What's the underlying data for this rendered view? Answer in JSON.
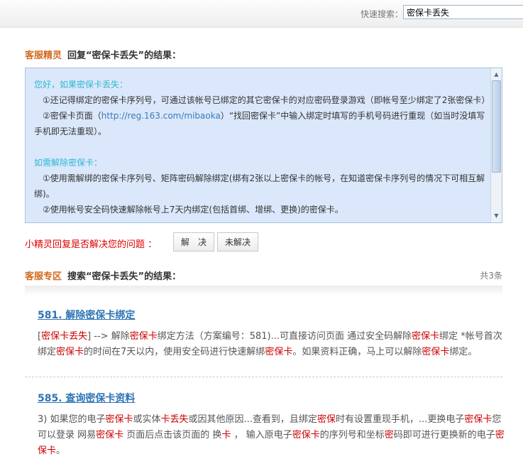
{
  "search": {
    "label": "快速搜索：",
    "value": "密保卡丢失"
  },
  "section1": {
    "accent": "客服精灵",
    "title": "回复“密保卡丢失”的结果："
  },
  "answer": {
    "intro": "您好，如果密保卡丢失：",
    "p1": "①还记得绑定的密保卡序列号，可通过该帐号已绑定的其它密保卡的对应密码登录游戏（即帐号至少绑定了2张密保卡）",
    "p2_pre": "②密保卡页面（",
    "p2_link": "http://reg.163.com/mibaoka",
    "p2_post": "）“找回密保卡”中输入绑定时填写的手机号码进行重现（如当时没填写手机即无法重现）。",
    "intro2": "如需解除密保卡：",
    "p3": "①使用需解绑的密保卡序列号、矩阵密码解除绑定(绑有2张以上密保卡的帐号，在知道密保卡序列号的情况下可相互解绑)。",
    "p4": "②使用帐号安全码快速解除帐号上7天内绑定(包括首绑、增绑、更换)的密保卡。"
  },
  "feedback": {
    "question": "小精灵回复是否解决您的问题 ：",
    "solved": "解　决",
    "unsolved": "未解决"
  },
  "section2": {
    "accent": "客服专区",
    "title": "搜索“密保卡丢失”的结果：",
    "count": "共3条"
  },
  "results": [
    {
      "title": "581. 解除密保卡绑定"
    },
    {
      "title": "585. 查询密保卡资料"
    }
  ]
}
